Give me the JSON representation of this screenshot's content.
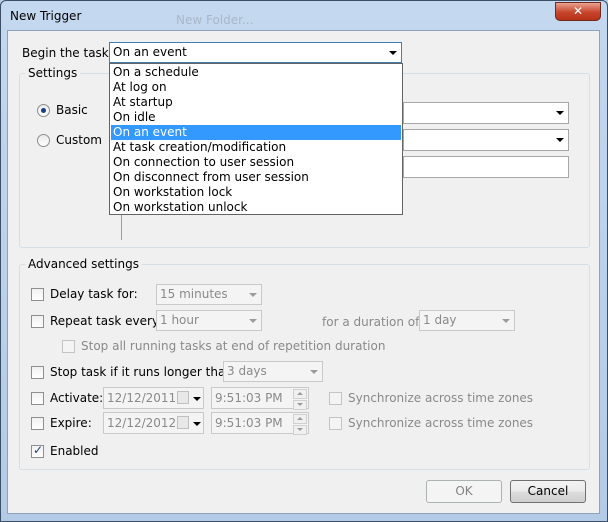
{
  "window": {
    "title": "New Trigger",
    "close_label": "✕"
  },
  "begin": {
    "label": "Begin the task:",
    "value": "On an event"
  },
  "dropdown": {
    "options": [
      "On a schedule",
      "At log on",
      "At startup",
      "On idle",
      "On an event",
      "At task creation/modification",
      "On connection to user session",
      "On disconnect from user session",
      "On workstation lock",
      "On workstation unlock"
    ],
    "selected_index": 4
  },
  "settings": {
    "group_label": "Settings",
    "basic_label": "Basic",
    "custom_label": "Custom",
    "basic_selected": true
  },
  "advanced": {
    "group_label": "Advanced settings",
    "delay_label": "Delay task for:",
    "delay_value": "15 minutes",
    "repeat_label": "Repeat task every:",
    "repeat_value": "1 hour",
    "duration_label": "for a duration of:",
    "duration_value": "1 day",
    "stop_all_label": "Stop all running tasks at end of repetition duration",
    "stop_if_label": "Stop task if it runs longer than:",
    "stop_if_value": "3 days",
    "activate_label": "Activate:",
    "activate_date": "12/12/2011",
    "activate_time": "9:51:03 PM",
    "expire_label": "Expire:",
    "expire_date": "12/12/2012",
    "expire_time": "9:51:03 PM",
    "sync_label": "Synchronize across time zones",
    "enabled_label": "Enabled",
    "enabled_checked": true
  },
  "buttons": {
    "ok": "OK",
    "cancel": "Cancel"
  },
  "background_snippet": "New Folder..."
}
